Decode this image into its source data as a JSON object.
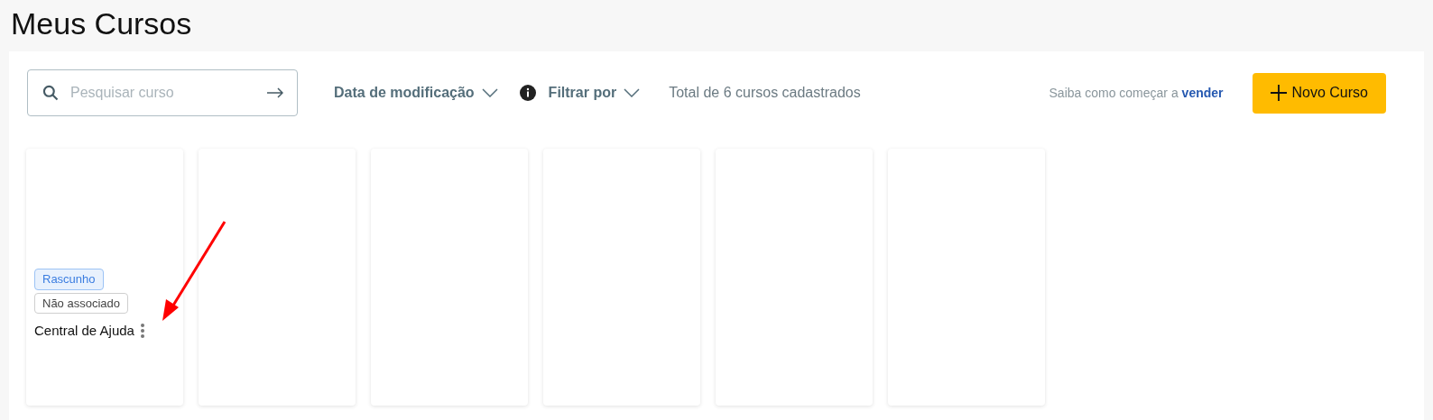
{
  "title": "Meus Cursos",
  "search": {
    "placeholder": "Pesquisar curso"
  },
  "sort": {
    "label": "Data de modificação"
  },
  "filter": {
    "label": "Filtrar por"
  },
  "total": "Total de 6 cursos cadastrados",
  "help": {
    "text": "Saiba como começar a",
    "link": "vender"
  },
  "new_button": "Novo Curso",
  "cards": [
    {
      "kind": "course",
      "tags": [
        {
          "label": "Rascunho",
          "kind": "status"
        },
        {
          "label": "Não associado",
          "kind": "plain"
        }
      ],
      "name": "Central de Ajuda"
    },
    {
      "kind": "blank"
    },
    {
      "kind": "blank"
    },
    {
      "kind": "blank"
    },
    {
      "kind": "blank"
    },
    {
      "kind": "blank"
    }
  ]
}
